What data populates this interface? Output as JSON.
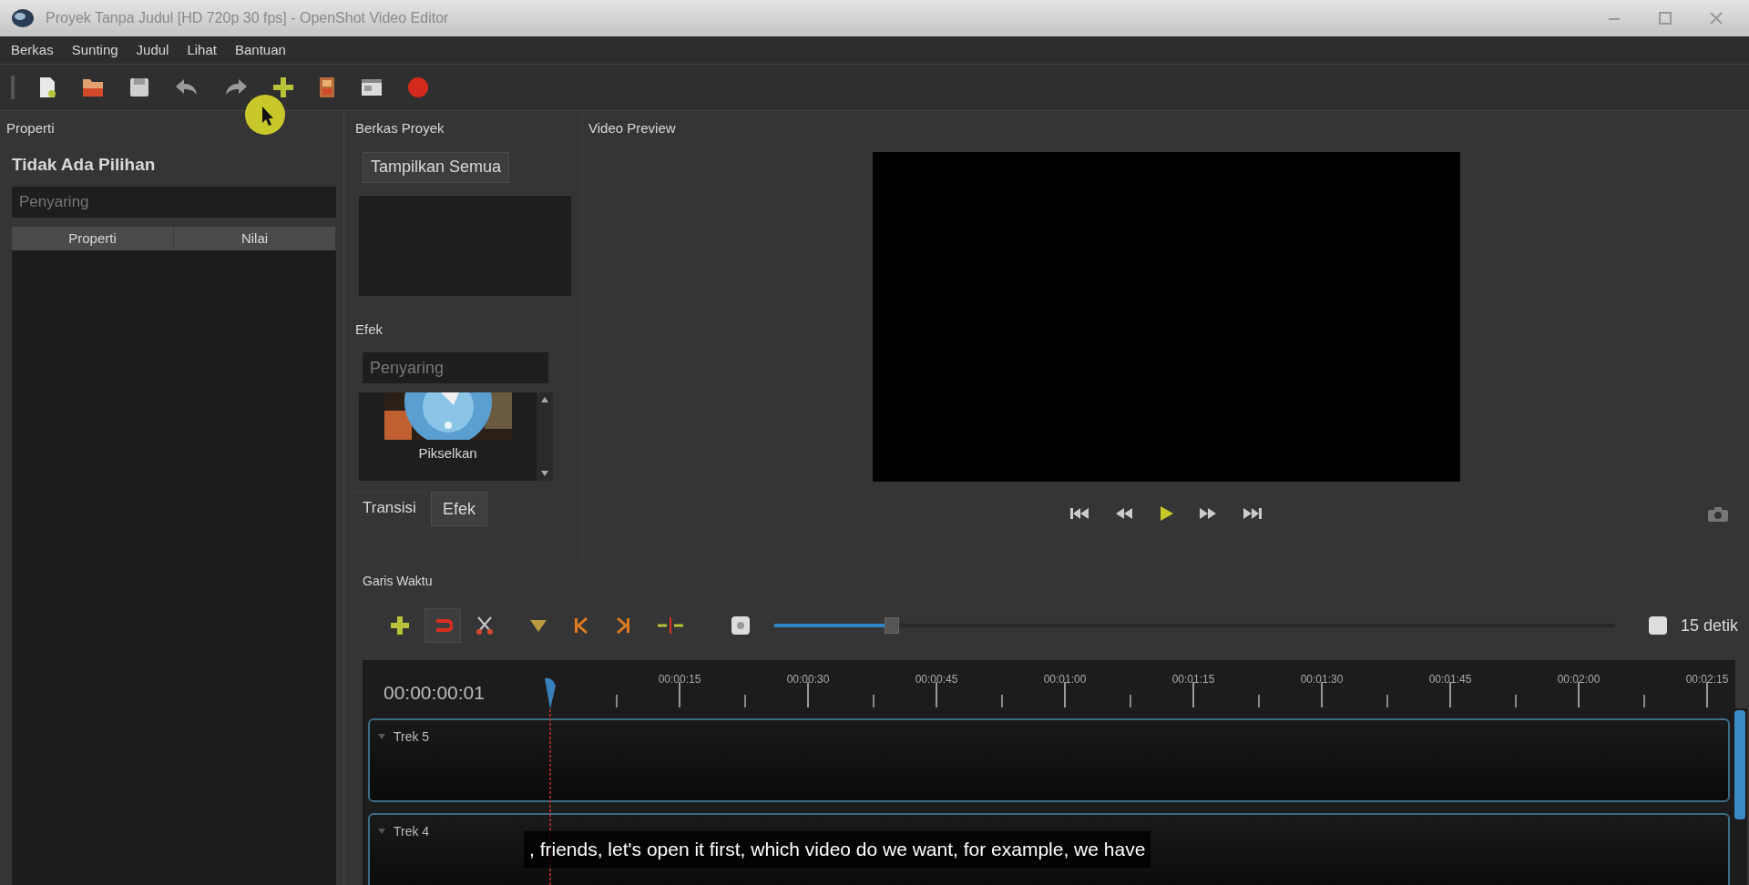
{
  "window": {
    "title": "Proyek Tanpa Judul [HD 720p 30 fps] - OpenShot Video Editor"
  },
  "menu": [
    "Berkas",
    "Sunting",
    "Judul",
    "Lihat",
    "Bantuan"
  ],
  "properties": {
    "title": "Properti",
    "heading": "Tidak Ada Pilihan",
    "filter": {
      "placeholder": "Penyaring"
    },
    "columns": [
      "Properti",
      "Nilai"
    ]
  },
  "project_files": {
    "title": "Berkas Proyek",
    "button": "Tampilkan Semua"
  },
  "effects": {
    "title": "Efek",
    "filter": {
      "placeholder": "Penyaring"
    },
    "items": [
      {
        "label": "Pikselkan"
      }
    ]
  },
  "tabs": [
    {
      "label": "Transisi",
      "selected": false
    },
    {
      "label": "Efek",
      "selected": true
    }
  ],
  "preview": {
    "title": "Video Preview"
  },
  "timeline": {
    "title": "Garis Waktu",
    "zoom": {
      "level": 0.14,
      "label": "15 detik"
    },
    "time": "00:00:00:01",
    "ruler": [
      "00:00:15",
      "00:00:30",
      "00:00:45",
      "00:01:00",
      "00:01:15",
      "00:01:30",
      "00:01:45",
      "00:02:00",
      "00:02:15"
    ],
    "tracks": [
      {
        "label": "Trek 5"
      },
      {
        "label": "Trek 4"
      }
    ]
  },
  "caption": ", friends, let's open it first, which video do we want, for example, we have"
}
